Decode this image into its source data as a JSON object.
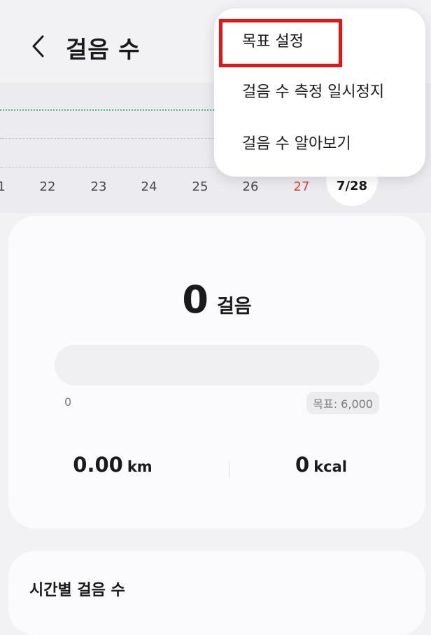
{
  "header": {
    "title": "걸음 수",
    "back_icon": "chevron-left-icon"
  },
  "chart": {
    "dates": [
      {
        "label": "1",
        "sunday": false
      },
      {
        "label": "22",
        "sunday": false
      },
      {
        "label": "23",
        "sunday": false
      },
      {
        "label": "24",
        "sunday": false
      },
      {
        "label": "25",
        "sunday": false
      },
      {
        "label": "26",
        "sunday": false
      },
      {
        "label": "27",
        "sunday": true
      }
    ],
    "selected_date": "7/28",
    "goal_line_color": "#46b886",
    "sunday_color": "#d9423a"
  },
  "summary": {
    "steps_value": "0",
    "steps_unit": "걸음",
    "progress": 0,
    "progress_min": "0",
    "goal_label": "목표: 6,000",
    "distance_value": "0.00",
    "distance_unit": "km",
    "calories_value": "0",
    "calories_unit": "kcal"
  },
  "hourly": {
    "title": "시간별 걸음 수"
  },
  "menu": {
    "items": [
      {
        "label": "목표 설정"
      },
      {
        "label": "걸음 수 측정 일시정지"
      },
      {
        "label": "걸음 수 알아보기"
      }
    ],
    "highlight_color": "#e61414"
  }
}
